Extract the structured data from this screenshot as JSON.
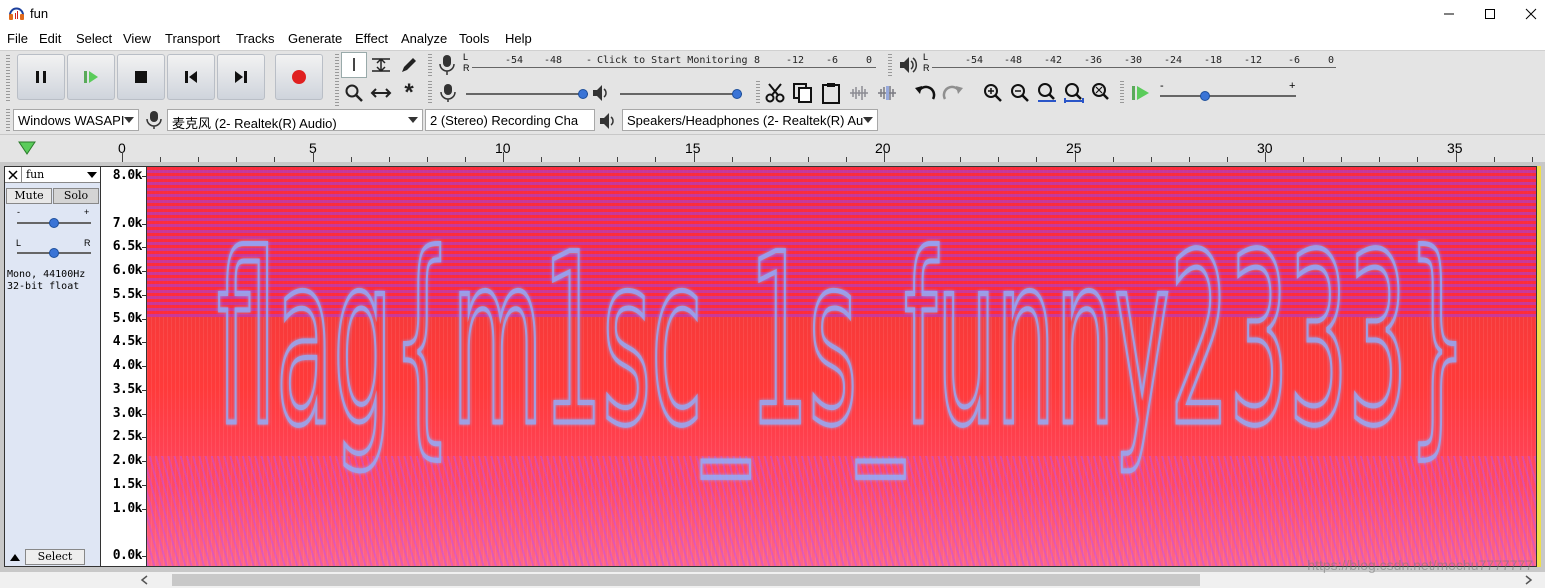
{
  "window": {
    "title": "fun"
  },
  "menu": [
    "File",
    "Edit",
    "Select",
    "View",
    "Transport",
    "Tracks",
    "Generate",
    "Effect",
    "Analyze",
    "Tools",
    "Help"
  ],
  "record_meter": {
    "channels": [
      "L",
      "R"
    ],
    "ticks": [
      "-54",
      "-48",
      "-",
      "Click to Start Monitoring",
      "8",
      "-12",
      "-6",
      "0"
    ]
  },
  "playback_meter": {
    "channels": [
      "L",
      "R"
    ],
    "ticks": [
      "-54",
      "-48",
      "-42",
      "-36",
      "-30",
      "-24",
      "-18",
      "-12",
      "-6",
      "0"
    ]
  },
  "play_speed": {
    "min": "-",
    "max": "+"
  },
  "devices": {
    "host": "Windows WASAPI",
    "recording_device": "麦克风 (2- Realtek(R) Audio)",
    "recording_channels": "2 (Stereo) Recording Cha",
    "playback_device": "Speakers/Headphones (2- Realtek(R) Au"
  },
  "timeline": {
    "labels": [
      "0",
      "5",
      "10",
      "15",
      "20",
      "25",
      "30",
      "35"
    ]
  },
  "track": {
    "name": "fun",
    "mute_label": "Mute",
    "solo_label": "Solo",
    "gain_minus": "-",
    "gain_plus": "+",
    "pan_left": "L",
    "pan_right": "R",
    "info_line1": "Mono, 44100Hz",
    "info_line2": "32-bit float",
    "select_label": "Select"
  },
  "freq_axis": {
    "labels": [
      "8.0k",
      "7.0k",
      "6.5k",
      "6.0k",
      "5.5k",
      "5.0k",
      "4.5k",
      "4.0k",
      "3.5k",
      "3.0k",
      "2.5k",
      "2.0k",
      "1.5k",
      "1.0k",
      "0.0k"
    ]
  },
  "spectrogram_text": "flag{m1sc_1s_funny2333}",
  "watermark": "https://blog.csdn.net/mochu7777777",
  "colors": {
    "accent": "#3a74d6",
    "spectro_hot": "#ff3a3a",
    "spectro_text": "#8fb0ff"
  }
}
